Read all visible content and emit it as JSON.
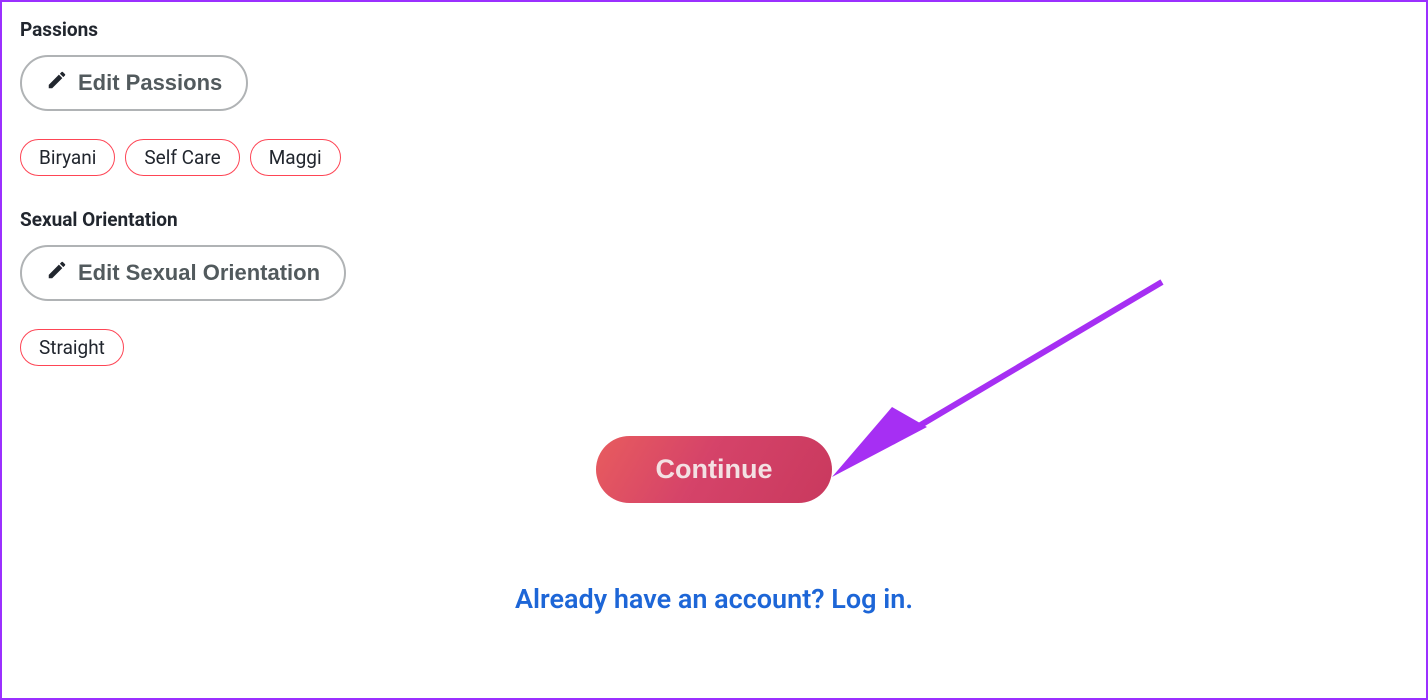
{
  "sections": {
    "passions": {
      "heading": "Passions",
      "edit_label": "Edit Passions",
      "chips": [
        "Biryani",
        "Self Care",
        "Maggi"
      ]
    },
    "orientation": {
      "heading": "Sexual Orientation",
      "edit_label": "Edit Sexual Orientation",
      "chips": [
        "Straight"
      ]
    }
  },
  "actions": {
    "continue_label": "Continue",
    "login_text": "Already have an account? Log in."
  },
  "colors": {
    "border": "#9B30FF",
    "chip_border": "#FE4555",
    "link": "#1D66D7",
    "arrow": "#A62FF3"
  }
}
